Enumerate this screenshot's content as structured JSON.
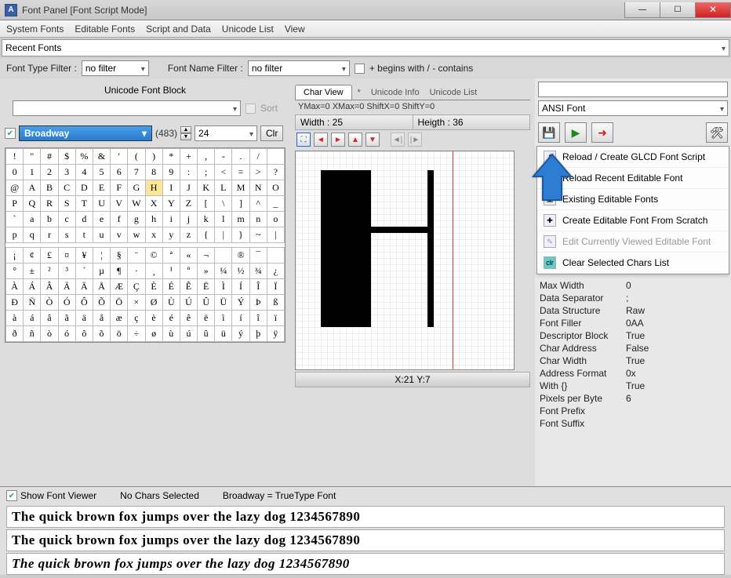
{
  "title": "Font Panel [Font Script Mode]",
  "menu": [
    "System Fonts",
    "Editable Fonts",
    "Script and Data",
    "Unicode List",
    "View"
  ],
  "recent_fonts_label": "Recent Fonts",
  "filters": {
    "font_type_label": "Font Type Filter :",
    "font_type_value": "no filter",
    "font_name_label": "Font Name Filter :",
    "font_name_value": "no filter",
    "begins_label": "+ begins with / - contains"
  },
  "unicode_block_label": "Unicode Font Block",
  "sort_label": "Sort",
  "font_name": "Broadway",
  "font_count": "(483)",
  "font_size": "24",
  "clr_label": "Clr",
  "char_rows": [
    [
      "!",
      "\"",
      "#",
      "$",
      "%",
      "&",
      "'",
      "(",
      ")",
      "*",
      "+",
      ",",
      "-",
      ".",
      "/"
    ],
    [
      "0",
      "1",
      "2",
      "3",
      "4",
      "5",
      "6",
      "7",
      "8",
      "9",
      ":",
      ";",
      "<",
      "=",
      ">",
      "?"
    ],
    [
      "@",
      "A",
      "B",
      "C",
      "D",
      "E",
      "F",
      "G",
      "H",
      "I",
      "J",
      "K",
      "L",
      "M",
      "N",
      "O"
    ],
    [
      "P",
      "Q",
      "R",
      "S",
      "T",
      "U",
      "V",
      "W",
      "X",
      "Y",
      "Z",
      "[",
      "\\",
      "]",
      "^",
      "_"
    ],
    [
      "`",
      "a",
      "b",
      "c",
      "d",
      "e",
      "f",
      "g",
      "h",
      "i",
      "j",
      "k",
      "l",
      "m",
      "n",
      "o"
    ],
    [
      "p",
      "q",
      "r",
      "s",
      "t",
      "u",
      "v",
      "w",
      "x",
      "y",
      "z",
      "{",
      "|",
      "}",
      "~",
      "|"
    ]
  ],
  "char_rows_ext": [
    [
      "¡",
      "¢",
      "£",
      "¤",
      "¥",
      "¦",
      "§",
      "¨",
      "©",
      "ª",
      "«",
      "¬",
      "",
      "®",
      "¯"
    ],
    [
      "°",
      "±",
      "²",
      "³",
      "´",
      "µ",
      "¶",
      "·",
      "¸",
      "¹",
      "º",
      "»",
      "¼",
      "½",
      "¾",
      "¿"
    ],
    [
      "À",
      "Á",
      "Â",
      "Ã",
      "Ä",
      "Å",
      "Æ",
      "Ç",
      "È",
      "É",
      "Ê",
      "Ë",
      "Ì",
      "Í",
      "Î",
      "Ï"
    ],
    [
      "Ð",
      "Ñ",
      "Ò",
      "Ó",
      "Ô",
      "Õ",
      "Ö",
      "×",
      "Ø",
      "Ù",
      "Ú",
      "Û",
      "Ü",
      "Ý",
      "Þ",
      "ß"
    ],
    [
      "à",
      "á",
      "â",
      "ã",
      "ä",
      "å",
      "æ",
      "ç",
      "è",
      "é",
      "ê",
      "ë",
      "ì",
      "í",
      "î",
      "ï"
    ],
    [
      "ð",
      "ñ",
      "ò",
      "ó",
      "ô",
      "õ",
      "ö",
      "÷",
      "ø",
      "ù",
      "ú",
      "û",
      "ü",
      "ý",
      "þ",
      "ÿ"
    ]
  ],
  "tabs": {
    "char_view": "Char View",
    "star": "*",
    "unicode_info": "Unicode Info",
    "unicode_list": "Unicode List"
  },
  "metrics_line": "YMax=0  XMax=0  ShiftX=0  ShiftY=0",
  "width_label": "Width : 25",
  "height_label": "Heigth : 36",
  "coord_label": "X:21 Y:7",
  "right": {
    "ansi_label": "ANSI Font",
    "context_menu": [
      "Reload / Create GLCD Font Script",
      "Reload Recent Editable Font",
      "Existing Editable Fonts",
      "Create Editable Font From Scratch",
      "Edit Currently Viewed Editable Font",
      "Clear Selected Chars List"
    ],
    "props": [
      [
        "Max Width",
        "0"
      ],
      [
        "Data Separator",
        ";"
      ],
      [
        "Data Structure",
        "Raw"
      ],
      [
        "Font Filler",
        "0AA"
      ],
      [
        "Descriptor Block",
        "True"
      ],
      [
        "Char Address",
        "False"
      ],
      [
        "Char Width",
        "True"
      ],
      [
        "Address Format",
        "0x"
      ],
      [
        "With {}",
        "True"
      ],
      [
        "Pixels per Byte",
        "6"
      ],
      [
        "Font Prefix",
        ""
      ],
      [
        "Font Suffix",
        ""
      ]
    ]
  },
  "viewer": {
    "show_label": "Show Font Viewer",
    "no_chars": "No Chars Selected",
    "font_info": "Broadway  = TrueType Font",
    "sample": "The quick brown fox jumps over the lazy dog 1234567890"
  }
}
